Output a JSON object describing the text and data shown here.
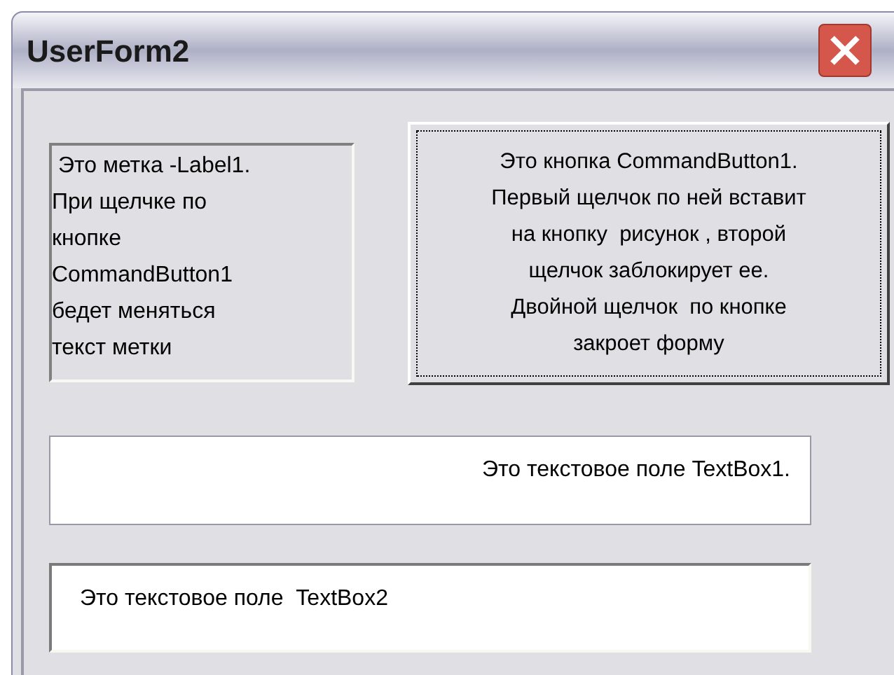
{
  "window": {
    "title": "UserForm2"
  },
  "label": {
    "text": " Это метка -Label1.\nПри щелчке по\nкнопке\nCommandButton1\nбедет меняться\nтекст метки"
  },
  "command_button": {
    "text": "Это кнопка CommandButton1.\nПервый щелчок по ней вставит\nна кнопку  рисунок , второй\nщелчок заблокирует ее.\nДвойной щелчок  по кнопке\nзакроет форму",
    "focused": true
  },
  "text_boxes": [
    {
      "value": "Это текстовое поле TextBox1.",
      "kind": "flat"
    },
    {
      "value": "Это текстовое поле  TextBox2",
      "kind": "sunken"
    }
  ]
}
